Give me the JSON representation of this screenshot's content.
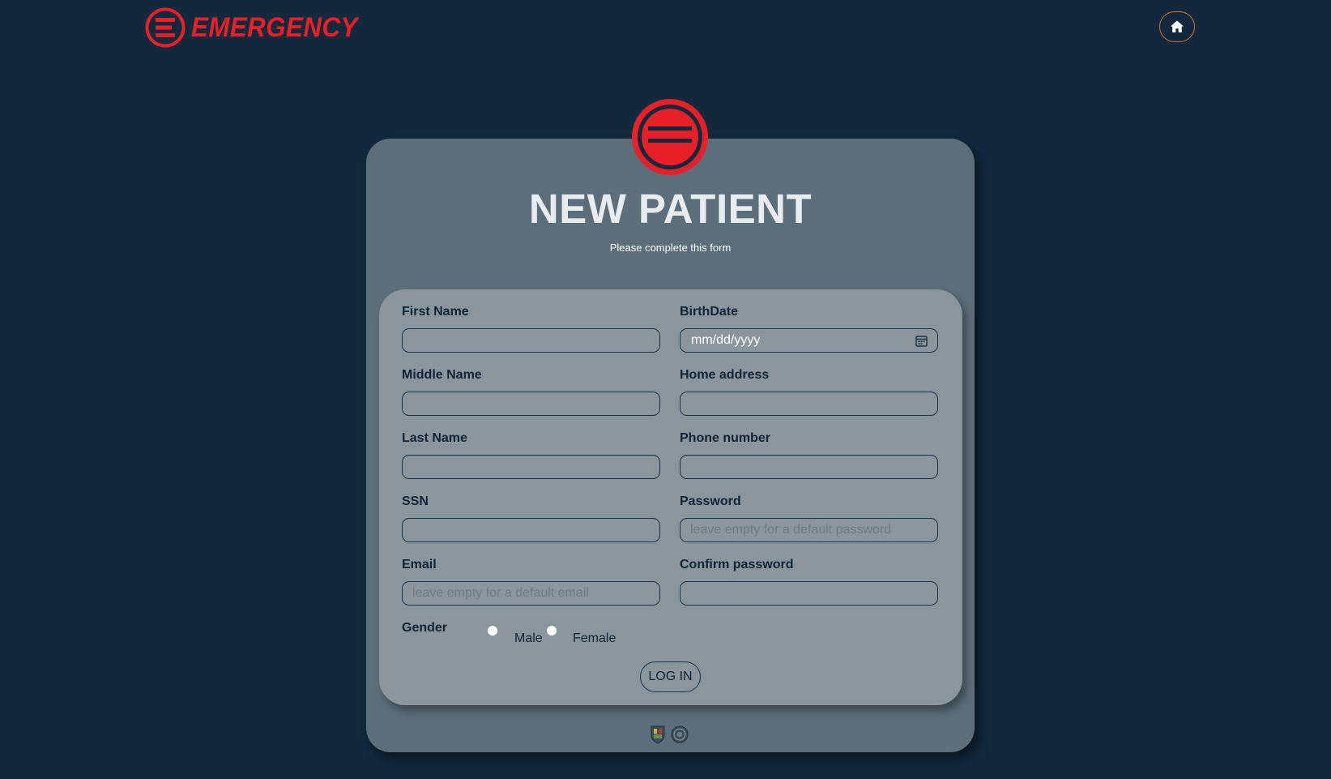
{
  "brand": {
    "name": "EMERGENCY",
    "color": "#e8202a"
  },
  "header": {
    "home_icon": "home-icon"
  },
  "page": {
    "title": "NEW PATIENT",
    "subtitle": "Please complete this form"
  },
  "form": {
    "left": [
      {
        "label": "First Name",
        "value": "",
        "placeholder": ""
      },
      {
        "label": "Middle Name",
        "value": "",
        "placeholder": ""
      },
      {
        "label": "Last Name",
        "value": "",
        "placeholder": ""
      },
      {
        "label": "SSN",
        "value": "",
        "placeholder": ""
      },
      {
        "label": "Email",
        "value": "",
        "placeholder": "leave empty for a default email"
      }
    ],
    "right": [
      {
        "label": "BirthDate",
        "value": "mm/dd/yyyy",
        "icon": "calendar-icon"
      },
      {
        "label": "Home address",
        "value": "",
        "placeholder": ""
      },
      {
        "label": "Phone number",
        "value": "",
        "placeholder": ""
      },
      {
        "label": "Password",
        "value": "",
        "placeholder": "leave empty for a default password"
      },
      {
        "label": "Confirm password",
        "value": "",
        "placeholder": ""
      }
    ],
    "gender": {
      "label": "Gender",
      "options": [
        "Male",
        "Female"
      ]
    },
    "submit_label": "LOG IN"
  },
  "colors": {
    "background": "#12283d",
    "outer_card": "#5c6e79",
    "form_card": "#8a959c",
    "accent": "#e8202a",
    "home_border": "#c8732f"
  }
}
